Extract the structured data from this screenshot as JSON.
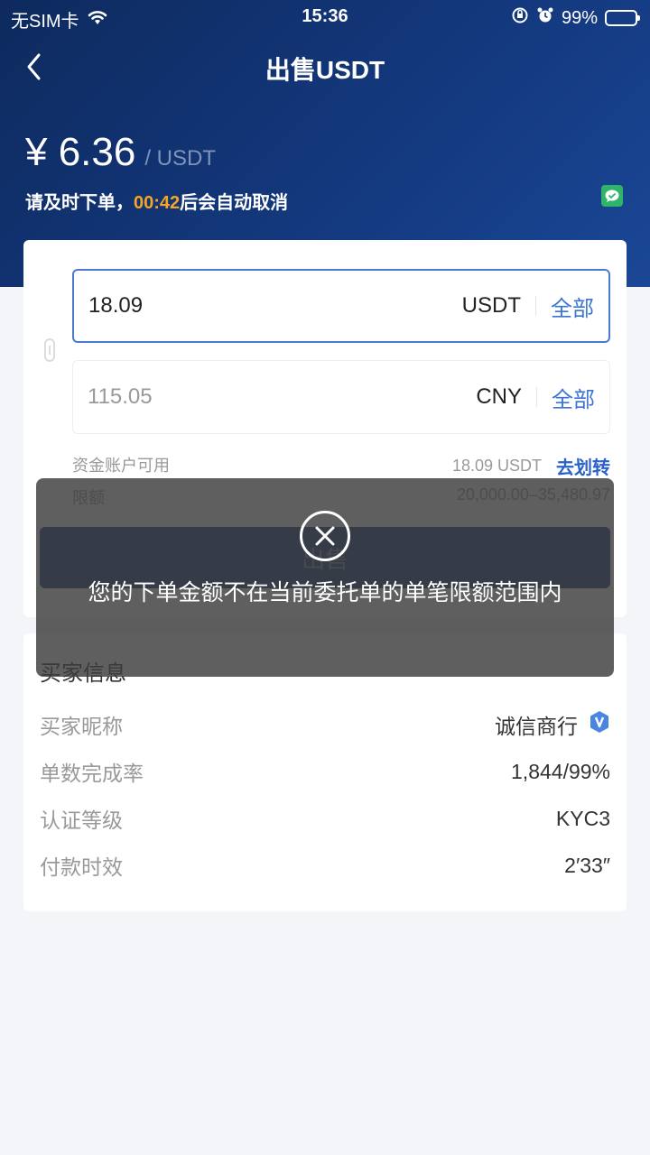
{
  "status_bar": {
    "carrier": "无SIM卡",
    "time": "15:36",
    "battery": "99%"
  },
  "nav": {
    "title": "出售USDT"
  },
  "price": {
    "value": "¥ 6.36",
    "unit": "/ USDT"
  },
  "countdown": {
    "prefix": "请及时下单，",
    "timer": "00:42",
    "suffix": "后会自动取消"
  },
  "form": {
    "usdt_input": {
      "value": "18.09",
      "currency": "USDT",
      "all_label": "全部"
    },
    "cny_input": {
      "value": "115.05",
      "currency": "CNY",
      "all_label": "全部"
    },
    "available_label": "资金账户可用",
    "available_value": "18.09 USDT",
    "transfer_label": "去划转",
    "limit_label": "限额",
    "limit_value": "20,000.00–35,480.97",
    "sell_button": "出售"
  },
  "buyer_info": {
    "title": "买家信息",
    "rows": [
      {
        "label": "买家昵称",
        "value": "诚信商行"
      },
      {
        "label": "单数完成率",
        "value": "1,844/99%"
      },
      {
        "label": "认证等级",
        "value": "KYC3"
      },
      {
        "label": "付款时效",
        "value": "2′33″"
      }
    ]
  },
  "toast": {
    "message": "您的下单金额不在当前委托单的单笔限额范围内"
  },
  "colors": {
    "accent": "#3b74d6",
    "timer": "#f5a623",
    "header": "#13387d"
  }
}
